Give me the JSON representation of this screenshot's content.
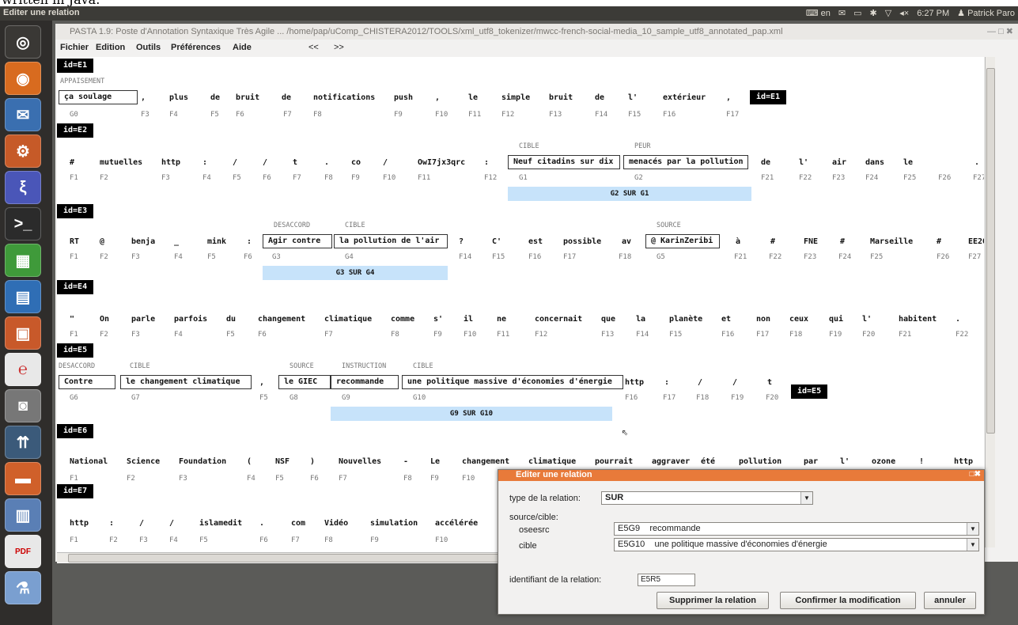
{
  "top_caption": "written in Java.",
  "system_bar": {
    "window_title": "Editer une relation",
    "keyboard": "en",
    "time": "6:27 PM",
    "user": "Patrick Paro"
  },
  "window": {
    "title": "PASTA 1.9: Poste d'Annotation Syntaxique Très Agile ... /home/pap/uComp_CHISTERA2012/TOOLS/xml_utf8_tokenizer/mwcc-french-social-media_10_sample_utf8_annotated_pap.xml",
    "menus": [
      "Fichier",
      "Edition",
      "Outils",
      "Préférences",
      "Aide"
    ],
    "nav": [
      "<<",
      ">>"
    ]
  },
  "blocks": {
    "e1": {
      "id": "id=E1",
      "inline_id": "id=E1",
      "labels": [
        "APPAISEMENT"
      ],
      "words": [
        "ça soulage",
        ",",
        "plus",
        "de",
        "bruit",
        "de",
        "notifications",
        "push",
        ",",
        "le",
        "simple",
        "bruit",
        "de",
        "l'",
        "extérieur",
        ","
      ],
      "fields": [
        "G0",
        "F3",
        "F4",
        "F5",
        "F6",
        "F7",
        "F8",
        "F9",
        "F10",
        "F11",
        "F12",
        "F13",
        "F14",
        "F15",
        "F16",
        "F17"
      ]
    },
    "e2": {
      "id": "id=E2",
      "labels": [
        "CIBLE",
        "PEUR"
      ],
      "words": [
        "#",
        "mutuelles",
        "http",
        ":",
        "/",
        "/",
        "t",
        ".",
        "co",
        "/",
        "OwI7jx3qrc",
        ":",
        "Neuf citadins sur dix",
        "menacés par la pollution",
        "de",
        "l'",
        "air",
        "dans",
        "le",
        "."
      ],
      "fields": [
        "F1",
        "F2",
        "F3",
        "F4",
        "F5",
        "F6",
        "F7",
        "F8",
        "F9",
        "F10",
        "F11",
        "F12",
        "G1",
        "G2",
        "F21",
        "F22",
        "F23",
        "F24",
        "F25",
        "F26",
        "F27"
      ],
      "relation": "G2 SUR G1"
    },
    "e3": {
      "id": "id=E3",
      "labels": [
        "DESACCORD",
        "CIBLE",
        "SOURCE"
      ],
      "words": [
        "RT",
        "@",
        "benja",
        "_",
        "mink",
        ":",
        "Agir contre",
        "la pollution de l'air",
        "?",
        "C'",
        "est",
        "possible",
        "av",
        "@ KarinZeribi",
        "à",
        "#",
        "FNE",
        "#",
        "Marseille",
        "#",
        "EE20"
      ],
      "fields": [
        "F1",
        "F2",
        "F3",
        "F4",
        "F5",
        "F6",
        "G3",
        "G4",
        "F14",
        "F15",
        "F16",
        "F17",
        "F18",
        "G5",
        "F21",
        "F22",
        "F23",
        "F24",
        "F25",
        "F26",
        "F27"
      ],
      "relation": "G3 SUR G4"
    },
    "e4": {
      "id": "id=E4",
      "words": [
        "\"",
        "On",
        "parle",
        "parfois",
        "du",
        "changement",
        "climatique",
        "comme",
        "s'",
        "il",
        "ne",
        "concernait",
        "que",
        "la",
        "planète",
        "et",
        "non",
        "ceux",
        "qui",
        "l'",
        "habitent",
        "."
      ],
      "fields": [
        "F1",
        "F2",
        "F3",
        "F4",
        "F5",
        "F6",
        "F7",
        "F8",
        "F9",
        "F10",
        "F11",
        "F12",
        "F13",
        "F14",
        "F15",
        "F16",
        "F17",
        "F18",
        "F19",
        "F20",
        "F21",
        "F22"
      ]
    },
    "e5": {
      "id": "id=E5",
      "inline_id": "id=E5",
      "labels": [
        "DESACCORD",
        "CIBLE",
        "SOURCE",
        "INSTRUCTION",
        "CIBLE"
      ],
      "words": [
        "Contre",
        "le changement climatique",
        ",",
        "le GIEC",
        "recommande",
        "une politique massive d'économies d'énergie",
        "http",
        ":",
        "/",
        "/",
        "t"
      ],
      "fields": [
        "G6",
        "G7",
        "F5",
        "G8",
        "G9",
        "G10",
        "F16",
        "F17",
        "F18",
        "F19",
        "F20"
      ],
      "relation": "G9 SUR G10"
    },
    "e6": {
      "id": "id=E6",
      "words": [
        "National",
        "Science",
        "Foundation",
        "(",
        "NSF",
        ")",
        "Nouvelles",
        "-",
        "Le",
        "changement",
        "climatique",
        "pourrait",
        "aggraver",
        "été",
        "pollution",
        "par",
        "l'",
        "ozone",
        "!",
        "http"
      ],
      "fields": [
        "F1",
        "F2",
        "F3",
        "F4",
        "F5",
        "F6",
        "F7",
        "F8",
        "F9",
        "F10"
      ]
    },
    "e7": {
      "id": "id=E7",
      "words": [
        "http",
        ":",
        "/",
        "/",
        "islamedit",
        ".",
        "com",
        "Vidéo",
        "simulation",
        "accélérée"
      ],
      "fields": [
        "F1",
        "F2",
        "F3",
        "F4",
        "F5",
        "F6",
        "F7",
        "F8",
        "F9",
        "F10"
      ]
    }
  },
  "dialog": {
    "title": "Editer une relation",
    "type_label": "type de la relation:",
    "type_value": "SUR",
    "source_cible_label": "source/cible:",
    "source_label": "oseesrc",
    "source_id": "E5G9",
    "source_text": "recommande",
    "cible_label": "cible",
    "cible_id": "E5G10",
    "cible_text": "une politique massive d'économies d'énergie",
    "id_label": "identifiant de la relation:",
    "id_value": "E5R5",
    "btn_delete": "Supprimer la relation",
    "btn_confirm": "Confirmer la modification",
    "btn_cancel": "annuler"
  }
}
